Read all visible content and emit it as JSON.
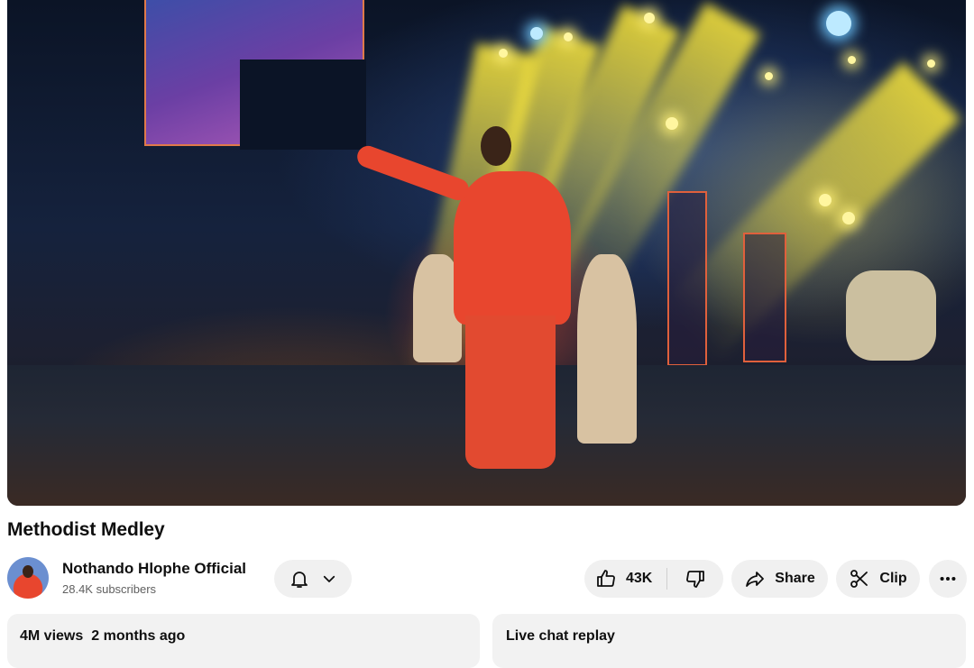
{
  "video": {
    "title": "Methodist Medley",
    "player_description": "Live stage performance: singer in red outfit with microphone, backup singers and band under yellow spotlights"
  },
  "channel": {
    "name": "Nothando Hlophe Official",
    "subscribers": "28.4K subscribers",
    "avatar": "channel-avatar"
  },
  "actions": {
    "like_count": "43K",
    "share_label": "Share",
    "clip_label": "Clip"
  },
  "icons": [
    "bell-icon",
    "chevron-down-icon",
    "thumbs-up-icon",
    "thumbs-down-icon",
    "share-arrow-icon",
    "scissors-icon",
    "more-horizontal-icon"
  ],
  "description": {
    "views": "4M views",
    "age": "2 months ago"
  },
  "chat": {
    "label": "Live chat replay"
  },
  "colors": {
    "pill_bg": "#f0f0f0",
    "card_bg": "#f2f2f2",
    "text": "#0f0f0f",
    "secondary_text": "#606060"
  }
}
